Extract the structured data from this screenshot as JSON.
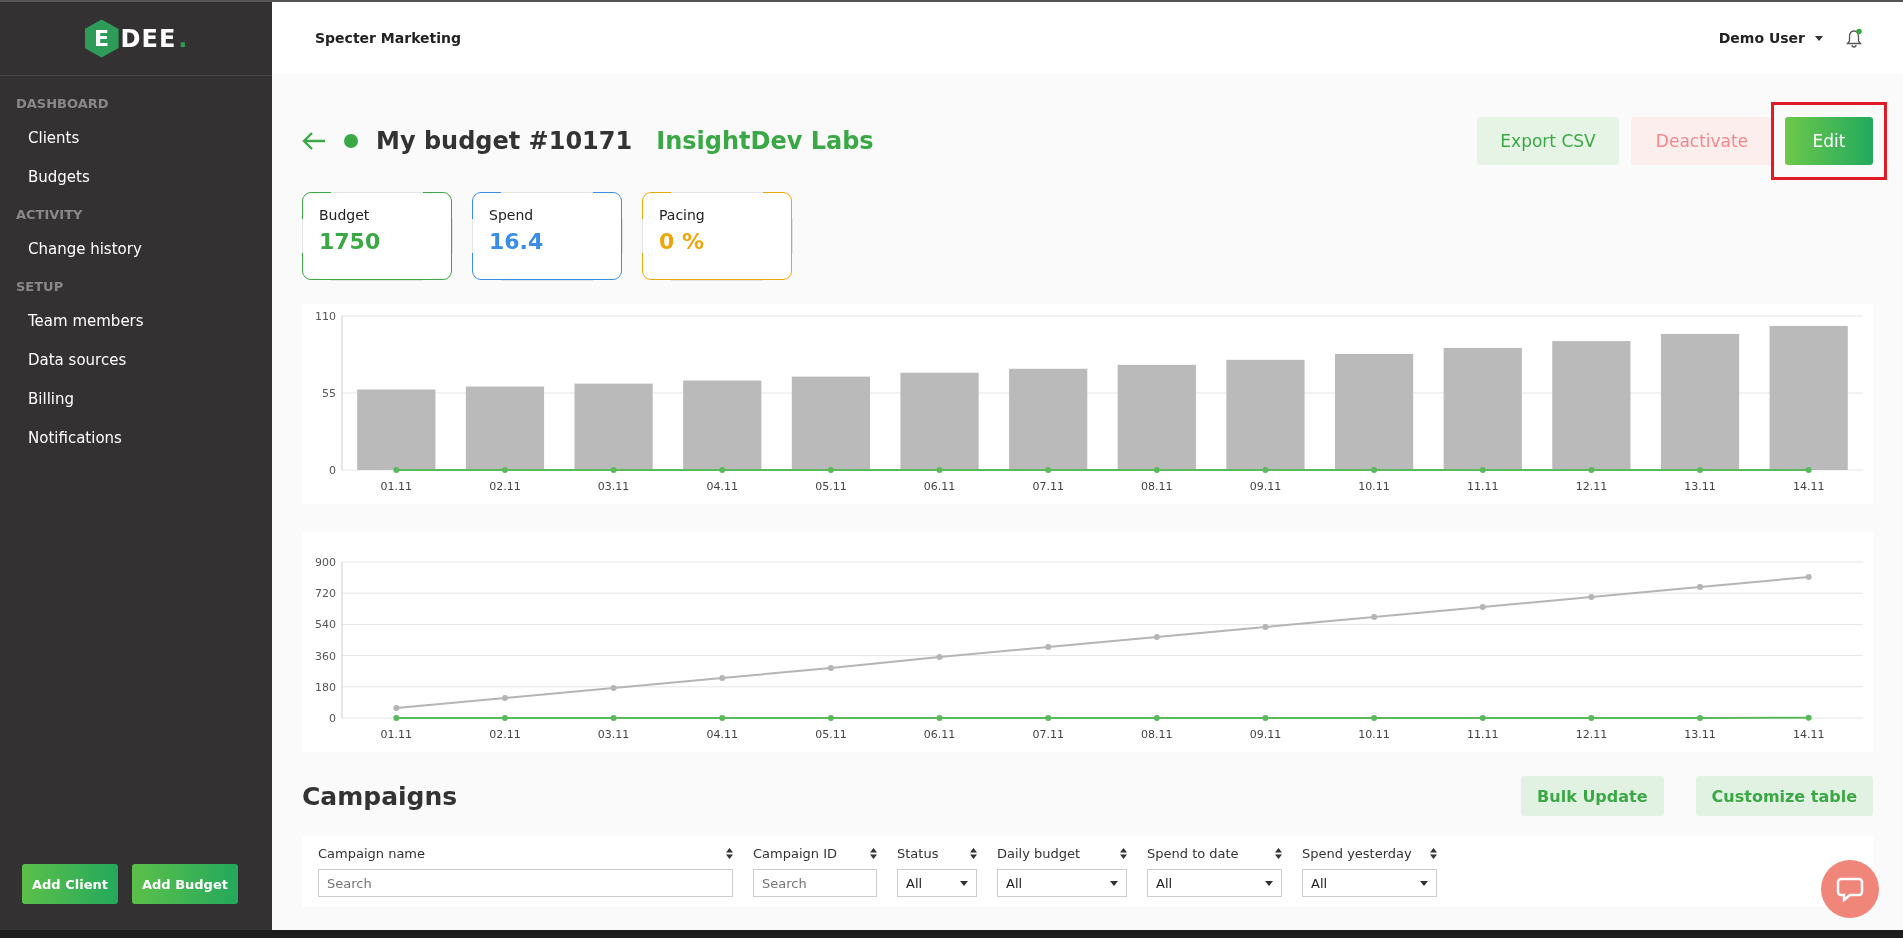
{
  "sidebar": {
    "logo": {
      "badge": "E",
      "word": "DEE",
      "dot": "."
    },
    "sections": [
      {
        "title": "DASHBOARD",
        "items": [
          {
            "label": "Clients",
            "selected": false
          },
          {
            "label": "Budgets",
            "selected": false
          }
        ]
      },
      {
        "title": "ACTIVITY",
        "items": [
          {
            "label": "Change history",
            "selected": false
          }
        ]
      },
      {
        "title": "SETUP",
        "items": [
          {
            "label": "Team members",
            "selected": false
          },
          {
            "label": "Data sources",
            "selected": false
          },
          {
            "label": "Billing",
            "selected": false
          },
          {
            "label": "Notifications",
            "selected": false
          }
        ]
      }
    ],
    "buttons": [
      "Add Client",
      "Add Budget"
    ]
  },
  "header": {
    "workspace": "Specter Marketing",
    "user": "Demo User",
    "notification_dot": true
  },
  "page": {
    "title": "My budget #10171",
    "client": "InsightDev Labs",
    "active": true,
    "actions": [
      {
        "label": "Export CSV",
        "kind": "soft"
      },
      {
        "label": "Deactivate",
        "kind": "danger"
      },
      {
        "label": "Edit",
        "kind": "primary",
        "highlighted": true
      }
    ]
  },
  "stats": [
    {
      "label": "Budget",
      "value": "1750",
      "color": "#3aa845"
    },
    {
      "label": "Spend",
      "value": "16.4",
      "color": "#3a8ee6"
    },
    {
      "label": "Pacing",
      "value": "0 %",
      "color": "#eea70a"
    }
  ],
  "daily_chart": {
    "chart_data": {
      "type": "bar",
      "categories": [
        "01.11",
        "02.11",
        "03.11",
        "04.11",
        "05.11",
        "06.11",
        "07.11",
        "08.11",
        "09.11",
        "10.11",
        "11.11",
        "12.11",
        "13.11",
        "14.11"
      ],
      "series": [
        {
          "color": "#bababa",
          "values": [
            57.5,
            59.6,
            61.7,
            63.9,
            66.7,
            69.5,
            72.3,
            75.1,
            78.7,
            82.9,
            87.2,
            92.1,
            97.2,
            102.9
          ]
        },
        {
          "color": "#5cb85c",
          "marker": true,
          "values": [
            0,
            0,
            0,
            0,
            0,
            0,
            0,
            0,
            0,
            0,
            0,
            0,
            0,
            0
          ]
        }
      ],
      "ylim": [
        0,
        110
      ],
      "yticks": [
        0,
        55,
        110
      ],
      "grid": true
    }
  },
  "cumulative_chart": {
    "chart_data": {
      "type": "line",
      "categories": [
        "01.11",
        "02.11",
        "03.11",
        "04.11",
        "05.11",
        "06.11",
        "07.11",
        "08.11",
        "09.11",
        "10.11",
        "11.11",
        "12.11",
        "13.11",
        "14.11"
      ],
      "series": [
        {
          "color": "#b5b5b5",
          "marker": true,
          "values": [
            58,
            115,
            173,
            231,
            288,
            352,
            410,
            467,
            525,
            583,
            640,
            698,
            756,
            813
          ]
        },
        {
          "color": "#5cb85c",
          "marker": true,
          "values": [
            0,
            0,
            0,
            0,
            0,
            0,
            0,
            0,
            0,
            0,
            0,
            0,
            0,
            2
          ]
        }
      ],
      "ylim": [
        0,
        900
      ],
      "yticks": [
        0,
        180,
        360,
        540,
        720,
        900
      ],
      "grid": true
    }
  },
  "campaigns": {
    "title": "Campaigns",
    "buttons": [
      "Bulk Update",
      "Customize table"
    ],
    "columns": [
      {
        "label": "Campaign name",
        "filter": {
          "kind": "search",
          "placeholder": "Search"
        }
      },
      {
        "label": "Campaign ID",
        "filter": {
          "kind": "search",
          "placeholder": "Search"
        }
      },
      {
        "label": "Status",
        "filter": {
          "kind": "select",
          "value": "All"
        }
      },
      {
        "label": "Daily budget",
        "filter": {
          "kind": "select",
          "value": "All"
        }
      },
      {
        "label": "Spend to date",
        "filter": {
          "kind": "select",
          "value": "All"
        }
      },
      {
        "label": "Spend yesterday",
        "filter": {
          "kind": "select",
          "value": "All"
        }
      }
    ]
  }
}
